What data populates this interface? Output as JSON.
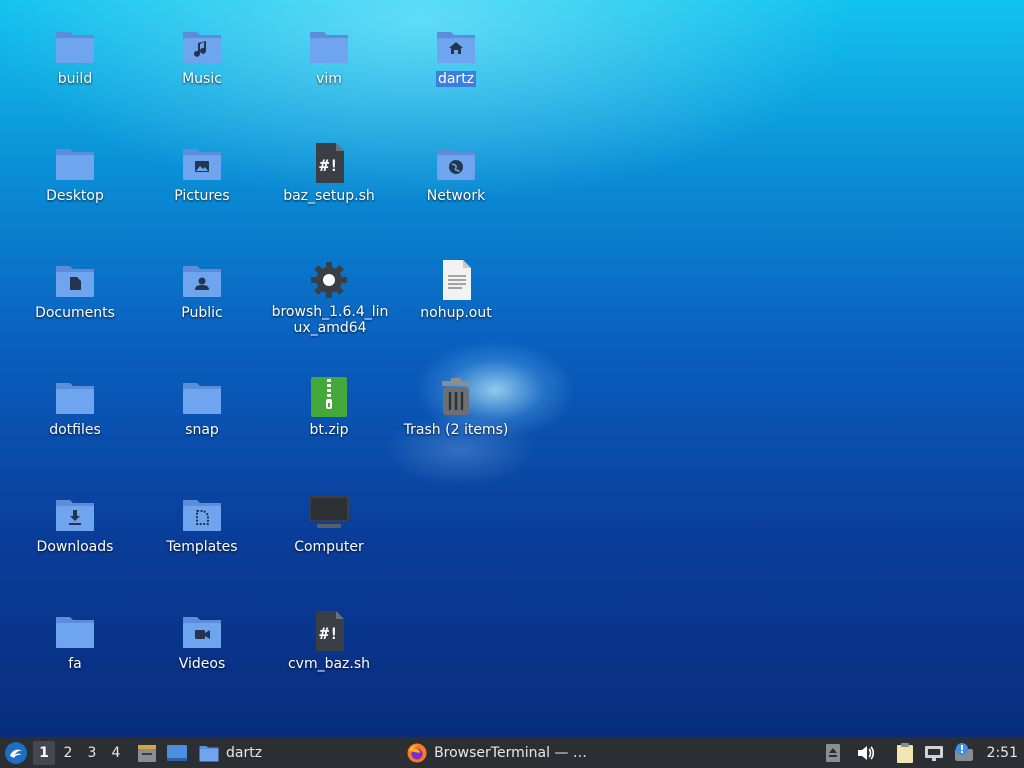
{
  "desktop": {
    "icons": [
      {
        "label": "build",
        "type": "folder"
      },
      {
        "label": "Music",
        "type": "folder-music"
      },
      {
        "label": "vim",
        "type": "folder"
      },
      {
        "label": "dartz",
        "type": "folder-home"
      },
      {
        "label": "Desktop",
        "type": "folder"
      },
      {
        "label": "Pictures",
        "type": "folder-pictures"
      },
      {
        "label": "baz_setup.sh",
        "type": "script"
      },
      {
        "label": "Network",
        "type": "folder-network"
      },
      {
        "label": "Documents",
        "type": "folder-documents"
      },
      {
        "label": "Public",
        "type": "folder-public"
      },
      {
        "label": "browsh_1.6.4_linux_amd64",
        "type": "executable"
      },
      {
        "label": "nohup.out",
        "type": "text-file"
      },
      {
        "label": "dotfiles",
        "type": "folder"
      },
      {
        "label": "snap",
        "type": "folder"
      },
      {
        "label": "bt.zip",
        "type": "zip"
      },
      {
        "label": "Trash (2 items)",
        "type": "trash"
      },
      {
        "label": "Downloads",
        "type": "folder-downloads"
      },
      {
        "label": "Templates",
        "type": "folder-templates"
      },
      {
        "label": "Computer",
        "type": "computer"
      },
      {
        "label": "fa",
        "type": "folder"
      },
      {
        "label": "Videos",
        "type": "folder-videos"
      },
      {
        "label": "cvm_baz.sh",
        "type": "script"
      }
    ]
  },
  "taskbar": {
    "workspaces": [
      "1",
      "2",
      "3",
      "4"
    ],
    "active_workspace": "1",
    "window_dartz": "dartz",
    "window_browser": "BrowserTerminal — …",
    "clock": "2:51"
  },
  "colors": {
    "folder": "#6a9fe8",
    "folder_tab": "#5b8ddb",
    "selection": "#3d7fe0",
    "taskbar": "#2b2e33"
  }
}
